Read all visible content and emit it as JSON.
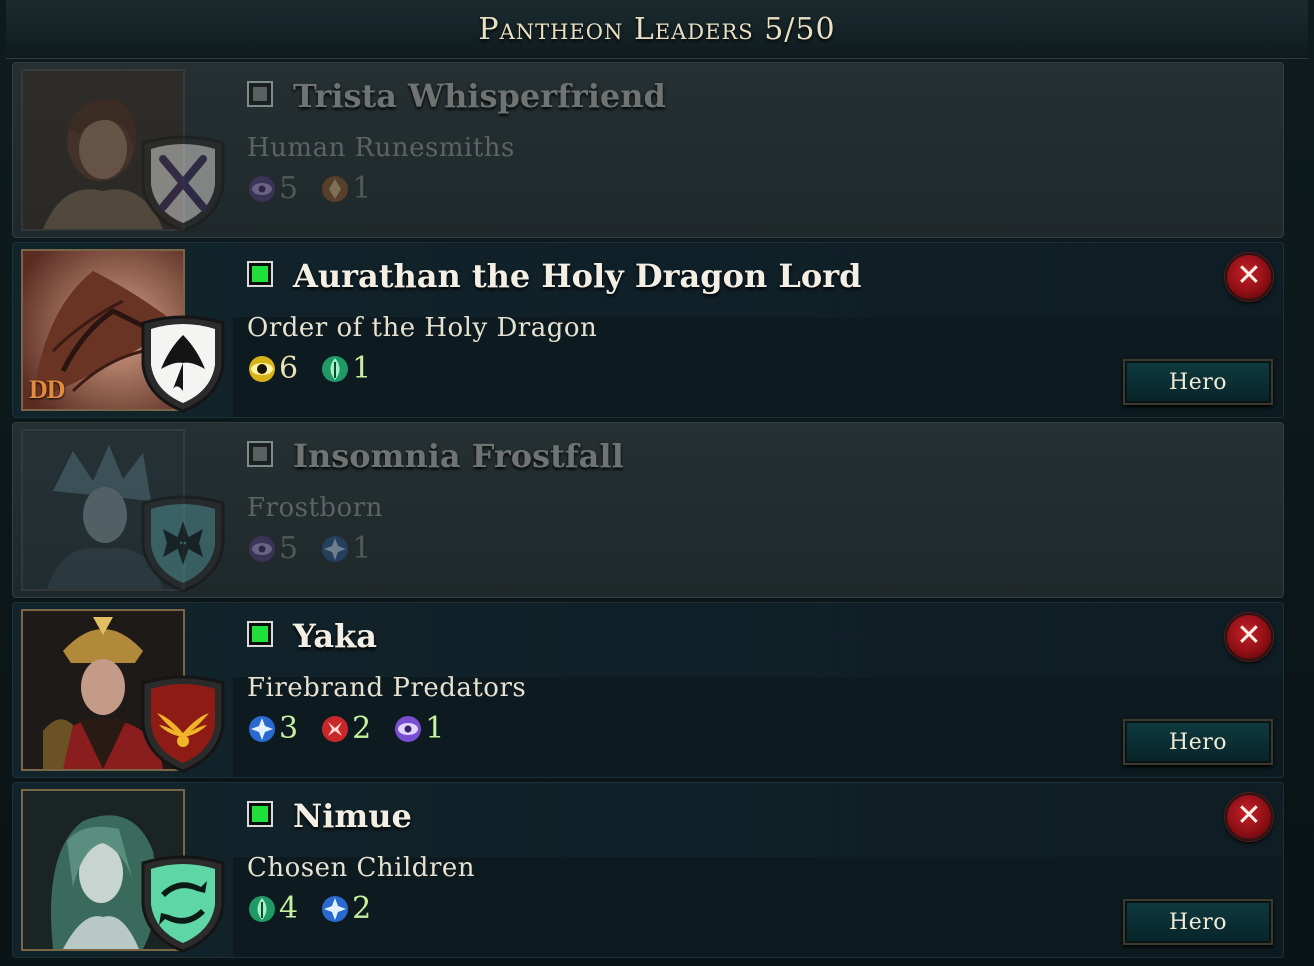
{
  "header": {
    "title": "Pantheon Leaders 5/50"
  },
  "colors": {
    "accent_green": "#22e03c",
    "remove_red": "#c8202a",
    "hero_button": "#0e3a40",
    "gold_text": "#e9dfc3"
  },
  "leaders": [
    {
      "name": "Trista Whisperfriend",
      "faction": "Human Runesmiths",
      "selected": false,
      "portrait_icon": "human-woman-portrait",
      "shield_icon": "crossed-bones-emblem",
      "affinities": [
        {
          "icon": "eye-affinity-icon",
          "value": "5"
        },
        {
          "icon": "earth-affinity-icon",
          "value": "1"
        }
      ]
    },
    {
      "name": "Aurathan the Holy Dragon Lord",
      "faction": "Order of the Holy Dragon",
      "selected": true,
      "tag": "DD",
      "portrait_icon": "dragon-portrait",
      "shield_icon": "dragon-emblem",
      "hero_label": "Hero",
      "remove_label": "✕",
      "affinities": [
        {
          "icon": "order-affinity-icon",
          "value": "6"
        },
        {
          "icon": "nature-affinity-icon",
          "value": "1"
        }
      ]
    },
    {
      "name": "Insomnia Frostfall",
      "faction": "Frostborn",
      "selected": false,
      "portrait_icon": "frost-woman-portrait",
      "shield_icon": "snowflake-emblem",
      "affinities": [
        {
          "icon": "eye-affinity-icon",
          "value": "5"
        },
        {
          "icon": "astral-affinity-icon",
          "value": "1"
        }
      ]
    },
    {
      "name": "Yaka",
      "faction": "Firebrand Predators",
      "selected": true,
      "portrait_icon": "crowned-warlord-portrait",
      "shield_icon": "phoenix-emblem",
      "hero_label": "Hero",
      "remove_label": "✕",
      "affinities": [
        {
          "icon": "astral-affinity-icon",
          "value": "3"
        },
        {
          "icon": "chaos-affinity-icon",
          "value": "2"
        },
        {
          "icon": "eye-affinity-icon",
          "value": "1"
        }
      ]
    },
    {
      "name": "Nimue",
      "faction": "Chosen Children",
      "selected": true,
      "portrait_icon": "sea-witch-portrait",
      "shield_icon": "twin-fish-emblem",
      "hero_label": "Hero",
      "remove_label": "✕",
      "affinities": [
        {
          "icon": "nature-affinity-icon",
          "value": "4"
        },
        {
          "icon": "astral-affinity-icon",
          "value": "2"
        }
      ]
    }
  ]
}
